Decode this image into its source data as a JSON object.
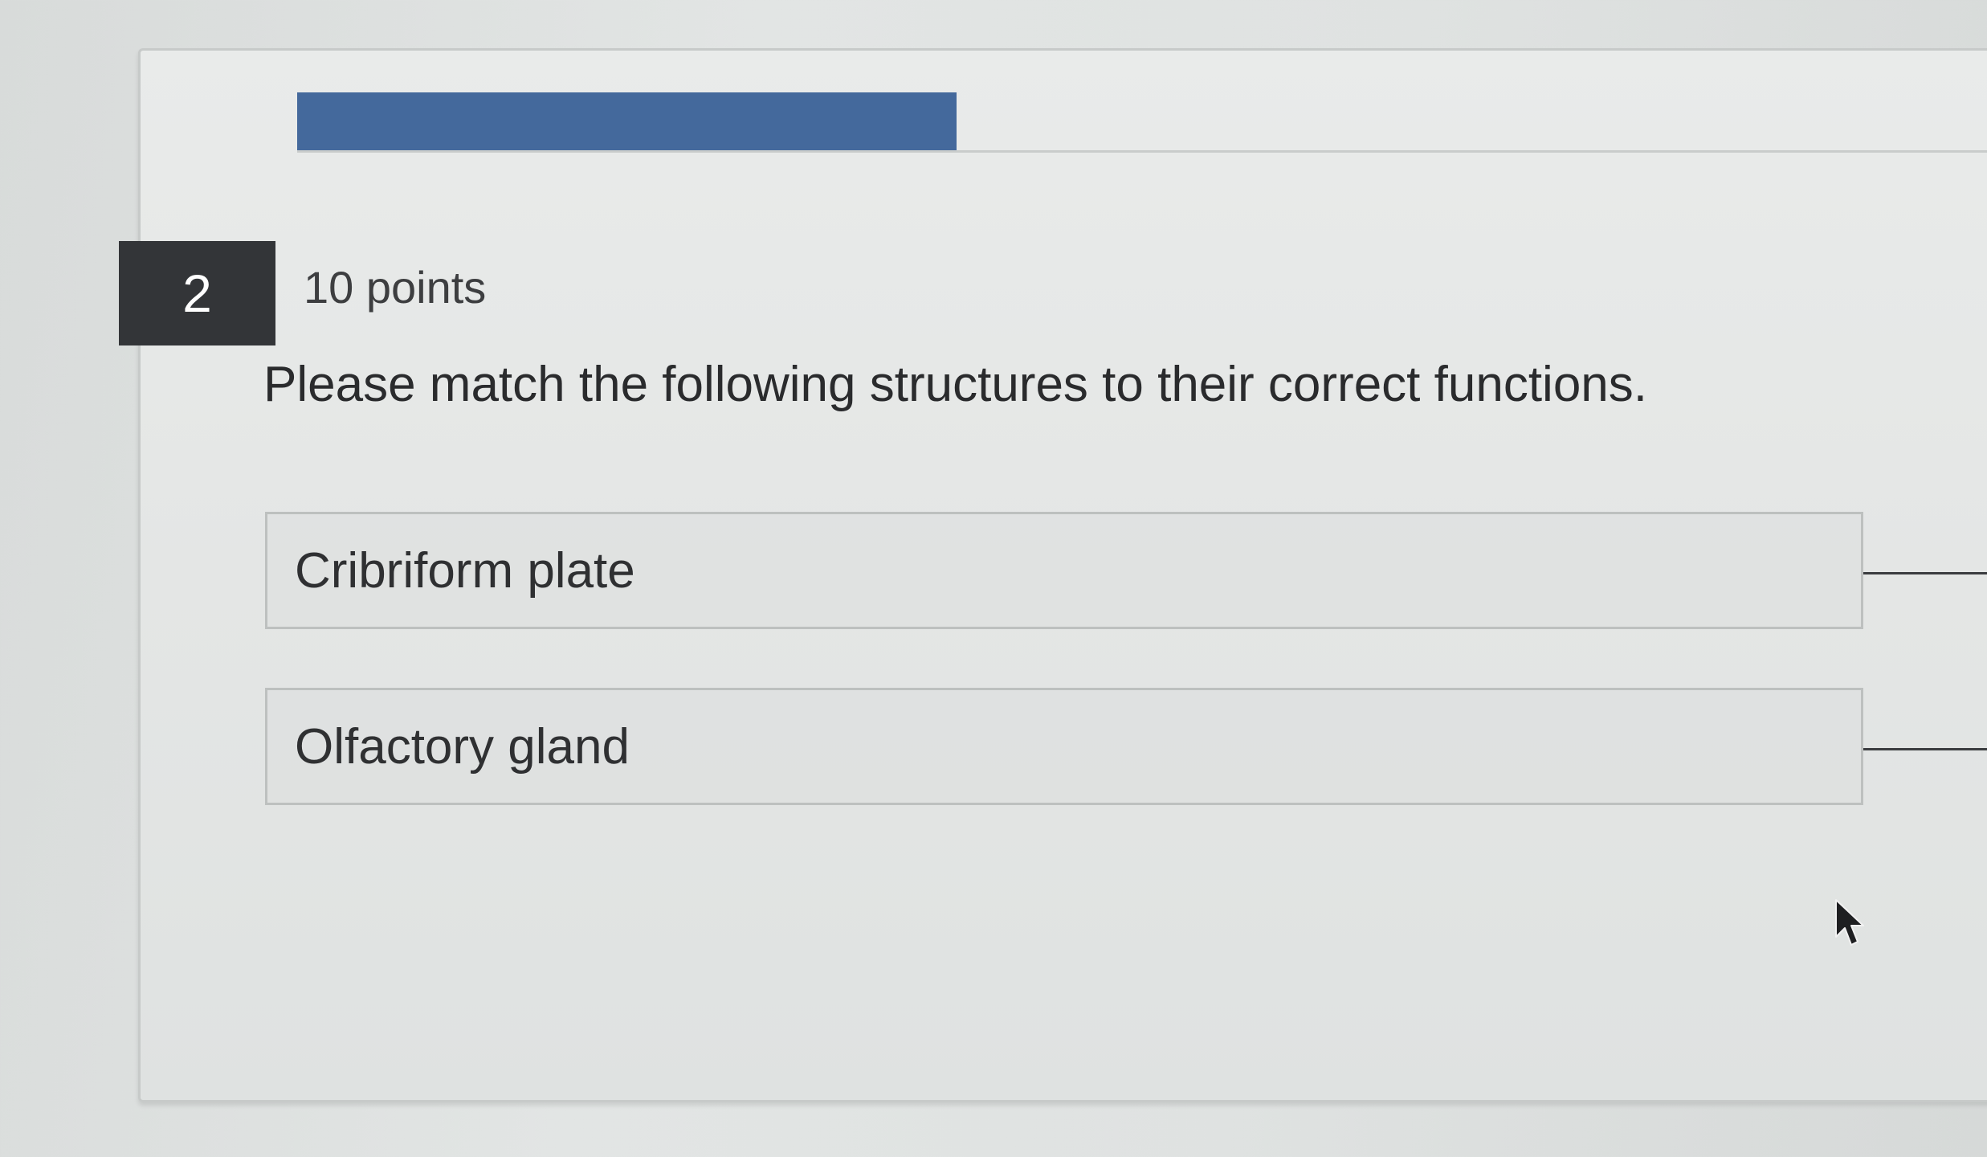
{
  "question": {
    "number": "2",
    "points": "10 points",
    "prompt": "Please match the following structures to their correct functions."
  },
  "progress": {
    "fraction": 0.39,
    "color": "#44699c"
  },
  "match_items": [
    {
      "label": "Cribriform plate"
    },
    {
      "label": "Olfactory gland"
    }
  ],
  "icons": {
    "cursor": "mouse-pointer-icon"
  }
}
